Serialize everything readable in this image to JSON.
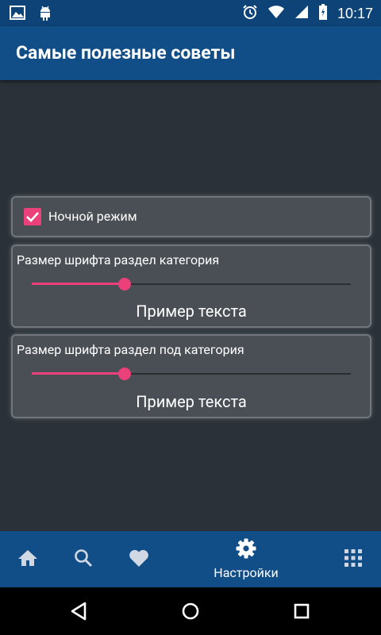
{
  "status_bar": {
    "time": "10:17"
  },
  "app_bar": {
    "title": "Самые полезные советы"
  },
  "settings": {
    "night_mode": {
      "label": "Ночной режим",
      "checked": true
    },
    "font_category": {
      "label": "Размер шрифта раздел категория",
      "sample": "Пример текста",
      "value": 0.29
    },
    "font_subcategory": {
      "label": "Размер шрифта раздел под категория",
      "sample": "Пример текста",
      "value": 0.29
    }
  },
  "bottom_nav": {
    "items": [
      {
        "icon": "home-icon"
      },
      {
        "icon": "search-icon"
      },
      {
        "icon": "heart-icon"
      },
      {
        "icon": "gear-icon",
        "label": "Настройки",
        "active": true
      },
      {
        "icon": "apps-grid-icon"
      }
    ]
  },
  "colors": {
    "primary": "#114d87",
    "status_bar": "#0e4377",
    "background": "#2a3138",
    "card": "#4a4f55",
    "accent": "#ec407a"
  }
}
